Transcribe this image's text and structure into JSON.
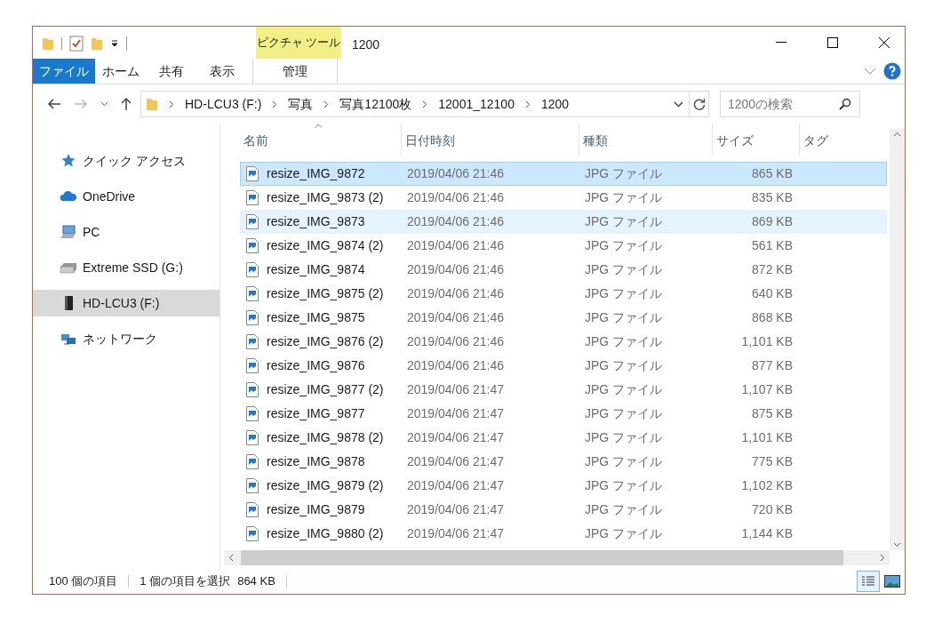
{
  "window": {
    "title": "1200",
    "context_tab": "ピクチャ ツール"
  },
  "ribbon_tabs": [
    {
      "label": "ファイル",
      "kind": "file",
      "selected": false
    },
    {
      "label": "ホーム",
      "kind": "tab",
      "selected": false
    },
    {
      "label": "共有",
      "kind": "tab",
      "selected": false
    },
    {
      "label": "表示",
      "kind": "tab",
      "selected": false
    },
    {
      "label": "管理",
      "kind": "context",
      "selected": false
    }
  ],
  "address_bar": {
    "path": [
      "HD-LCU3 (F:)",
      "写真",
      "写真12100枚",
      "12001_12100",
      "1200"
    ]
  },
  "search": {
    "placeholder": "1200の検索"
  },
  "sidebar": {
    "items": [
      {
        "label": "クイック アクセス",
        "kind": "star",
        "selected": false
      },
      {
        "label": "OneDrive",
        "kind": "cloud",
        "selected": false
      },
      {
        "label": "PC",
        "kind": "pc",
        "selected": false
      },
      {
        "label": "Extreme SSD (G:)",
        "kind": "drive",
        "selected": false
      },
      {
        "label": "HD-LCU3 (F:)",
        "kind": "hdd",
        "selected": true
      },
      {
        "label": "ネットワーク",
        "kind": "network",
        "selected": false
      }
    ]
  },
  "table": {
    "columns": [
      "名前",
      "日付時刻",
      "種類",
      "サイズ",
      "タグ"
    ],
    "rows": [
      {
        "name": "resize_IMG_9872",
        "date": "2019/04/06 21:46",
        "type": "JPG ファイル",
        "size": "865 KB",
        "selected": true,
        "hovered": false
      },
      {
        "name": "resize_IMG_9873 (2)",
        "date": "2019/04/06 21:46",
        "type": "JPG ファイル",
        "size": "835 KB",
        "selected": false,
        "hovered": false
      },
      {
        "name": "resize_IMG_9873",
        "date": "2019/04/06 21:46",
        "type": "JPG ファイル",
        "size": "869 KB",
        "selected": false,
        "hovered": true
      },
      {
        "name": "resize_IMG_9874 (2)",
        "date": "2019/04/06 21:46",
        "type": "JPG ファイル",
        "size": "561 KB",
        "selected": false,
        "hovered": false
      },
      {
        "name": "resize_IMG_9874",
        "date": "2019/04/06 21:46",
        "type": "JPG ファイル",
        "size": "872 KB",
        "selected": false,
        "hovered": false
      },
      {
        "name": "resize_IMG_9875 (2)",
        "date": "2019/04/06 21:46",
        "type": "JPG ファイル",
        "size": "640 KB",
        "selected": false,
        "hovered": false
      },
      {
        "name": "resize_IMG_9875",
        "date": "2019/04/06 21:46",
        "type": "JPG ファイル",
        "size": "868 KB",
        "selected": false,
        "hovered": false
      },
      {
        "name": "resize_IMG_9876 (2)",
        "date": "2019/04/06 21:46",
        "type": "JPG ファイル",
        "size": "1,101 KB",
        "selected": false,
        "hovered": false
      },
      {
        "name": "resize_IMG_9876",
        "date": "2019/04/06 21:46",
        "type": "JPG ファイル",
        "size": "877 KB",
        "selected": false,
        "hovered": false
      },
      {
        "name": "resize_IMG_9877 (2)",
        "date": "2019/04/06 21:47",
        "type": "JPG ファイル",
        "size": "1,107 KB",
        "selected": false,
        "hovered": false
      },
      {
        "name": "resize_IMG_9877",
        "date": "2019/04/06 21:47",
        "type": "JPG ファイル",
        "size": "875 KB",
        "selected": false,
        "hovered": false
      },
      {
        "name": "resize_IMG_9878 (2)",
        "date": "2019/04/06 21:47",
        "type": "JPG ファイル",
        "size": "1,101 KB",
        "selected": false,
        "hovered": false
      },
      {
        "name": "resize_IMG_9878",
        "date": "2019/04/06 21:47",
        "type": "JPG ファイル",
        "size": "775 KB",
        "selected": false,
        "hovered": false
      },
      {
        "name": "resize_IMG_9879 (2)",
        "date": "2019/04/06 21:47",
        "type": "JPG ファイル",
        "size": "1,102 KB",
        "selected": false,
        "hovered": false
      },
      {
        "name": "resize_IMG_9879",
        "date": "2019/04/06 21:47",
        "type": "JPG ファイル",
        "size": "720 KB",
        "selected": false,
        "hovered": false
      },
      {
        "name": "resize_IMG_9880 (2)",
        "date": "2019/04/06 21:47",
        "type": "JPG ファイル",
        "size": "1,144 KB",
        "selected": false,
        "hovered": false
      }
    ]
  },
  "status_bar": {
    "item_count": "100 個の項目",
    "selection": "1 個の項目を選択",
    "selection_size": "864 KB"
  }
}
